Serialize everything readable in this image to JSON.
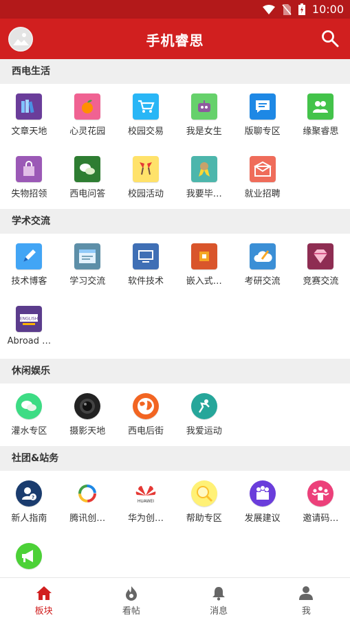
{
  "status_bar": {
    "time": "10:00"
  },
  "app_bar": {
    "title": "手机睿思"
  },
  "sections": [
    {
      "title": "西电生活",
      "items": [
        {
          "label": "文章天地",
          "color": "#6a3d9a",
          "icon": "books-icon"
        },
        {
          "label": "心灵花园",
          "color": "#f06292",
          "icon": "fruit-icon"
        },
        {
          "label": "校园交易",
          "color": "#29b6f6",
          "icon": "cart-icon"
        },
        {
          "label": "我是女生",
          "color": "#66d16b",
          "icon": "robot-icon"
        },
        {
          "label": "版聊专区",
          "color": "#1e88e5",
          "icon": "chat-icon"
        },
        {
          "label": "缘聚睿思",
          "color": "#43c34a",
          "icon": "people-icon"
        },
        {
          "label": "失物招领",
          "color": "#9b59b6",
          "icon": "bag-icon"
        },
        {
          "label": "西电问答",
          "color": "#2e7d32",
          "icon": "wechat-icon"
        },
        {
          "label": "校园活动",
          "color": "#ffe26a",
          "icon": "cheers-icon"
        },
        {
          "label": "我要毕…",
          "color": "#4db6ac",
          "icon": "medal-icon"
        },
        {
          "label": "就业招聘",
          "color": "#ef6c5a",
          "icon": "mail-icon"
        }
      ]
    },
    {
      "title": "学术交流",
      "items": [
        {
          "label": "技术博客",
          "color": "#42a5f5",
          "icon": "pencil-icon"
        },
        {
          "label": "学习交流",
          "color": "#5d8fa8",
          "icon": "window-icon"
        },
        {
          "label": "软件技术",
          "color": "#3f6fb5",
          "icon": "monitor-icon"
        },
        {
          "label": "嵌入式…",
          "color": "#d9552b",
          "icon": "chip-icon"
        },
        {
          "label": "考研交流",
          "color": "#3b8fd6",
          "icon": "cloud-icon"
        },
        {
          "label": "竞赛交流",
          "color": "#8e2d52",
          "icon": "diamond-icon"
        },
        {
          "label": "Abroad …",
          "color": "#5b3c8c",
          "icon": "english-icon"
        }
      ]
    },
    {
      "title": "休闲娱乐",
      "items": [
        {
          "label": "灌水专区",
          "color": "#3ddc84",
          "icon": "bubbles-icon"
        },
        {
          "label": "摄影天地",
          "color": "#222222",
          "icon": "lens-icon"
        },
        {
          "label": "西电后街",
          "color": "#f26522",
          "icon": "globe-icon"
        },
        {
          "label": "我爱运动",
          "color": "#26a69a",
          "icon": "sport-icon"
        }
      ]
    },
    {
      "title": "社团&站务",
      "items": [
        {
          "label": "新人指南",
          "color": "#1a3c6e",
          "icon": "newbie-icon"
        },
        {
          "label": "腾讯创…",
          "color": "#ffffff",
          "icon": "tencent-icon"
        },
        {
          "label": "华为创…",
          "color": "#ffffff",
          "icon": "huawei-icon"
        },
        {
          "label": "帮助专区",
          "color": "#fff176",
          "icon": "magnifier-icon"
        },
        {
          "label": "发展建议",
          "color": "#6a3ddb",
          "icon": "team-icon"
        },
        {
          "label": "邀请码…",
          "color": "#ec407a",
          "icon": "invite-icon"
        },
        {
          "label": "",
          "color": "#4cd137",
          "icon": "megaphone-icon"
        }
      ]
    }
  ],
  "bottom_nav": [
    {
      "label": "板块",
      "icon": "home-icon",
      "active": true
    },
    {
      "label": "看帖",
      "icon": "flame-icon",
      "active": false
    },
    {
      "label": "消息",
      "icon": "bell-icon",
      "active": false
    },
    {
      "label": "我",
      "icon": "person-icon",
      "active": false
    }
  ],
  "theme": {
    "primary": "#d11f1f",
    "status": "#b3191a",
    "section_bg": "#efefef"
  }
}
